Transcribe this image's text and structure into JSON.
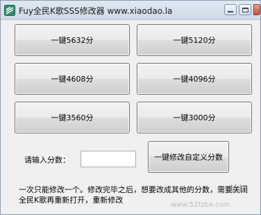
{
  "window": {
    "title": "Fuy全民K歌SSS修改器 www.xiaodao.la"
  },
  "buttons": {
    "b1": "一键5632分",
    "b2": "一键5120分",
    "b3": "一键4608分",
    "b4": "一键4096分",
    "b5": "一键3560分",
    "b6": "一键3000分",
    "custom": "一键修改自定义分数"
  },
  "score": {
    "label": "请输入分数：",
    "value": "",
    "placeholder": ""
  },
  "note": "一次只能修改一个。修改完毕之后，想要改成其他的分数，需要关闭全民K歌再重新打开，重新修改",
  "watermark": {
    "site_top": "论坛",
    "url": "www.52fzba.com"
  },
  "icons": {
    "app": "app-icon",
    "minimize": "minimize-icon",
    "maximize": "maximize-icon",
    "close": "close-icon"
  }
}
